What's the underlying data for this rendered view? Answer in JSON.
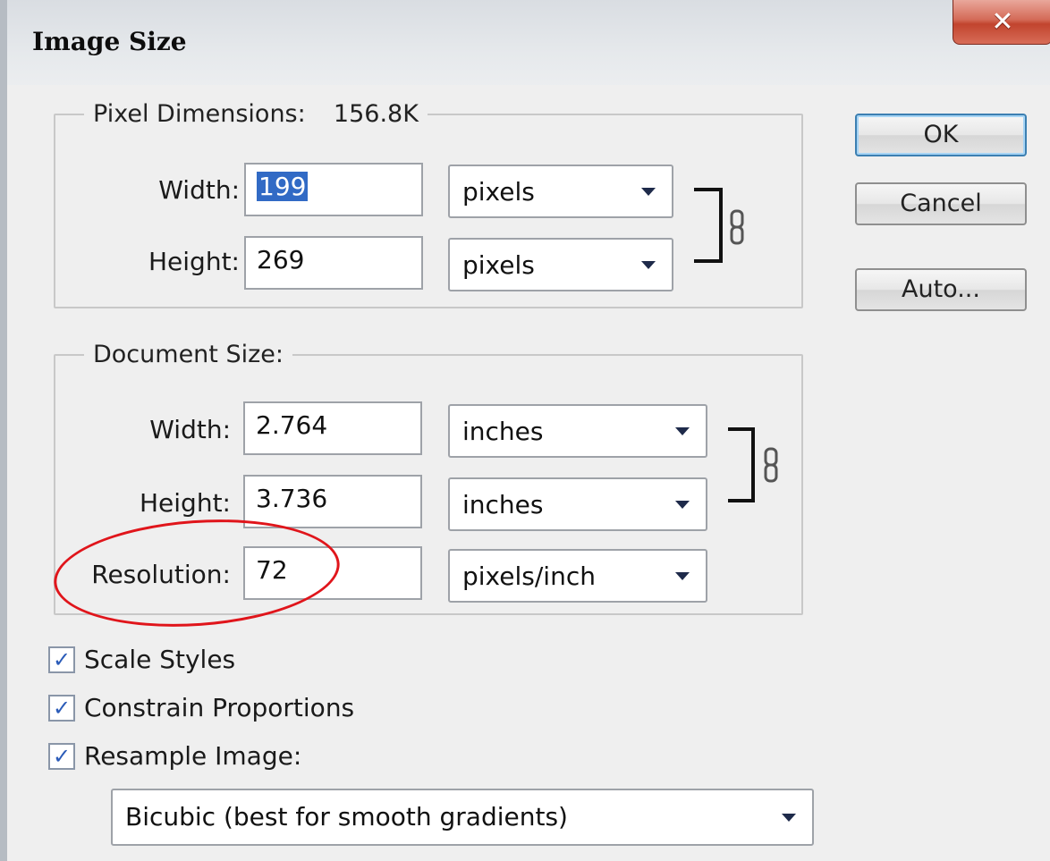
{
  "window": {
    "title": "Image Size",
    "close_glyph": "✕"
  },
  "pixel_dimensions": {
    "legend_label": "Pixel Dimensions:",
    "legend_value": "156.8K",
    "width_label": "Width:",
    "width_value": "199",
    "width_unit": "pixels",
    "height_label": "Height:",
    "height_value": "269",
    "height_unit": "pixels",
    "link_icon": "chain-link-icon"
  },
  "document_size": {
    "legend_label": "Document Size:",
    "width_label": "Width:",
    "width_value": "2.764",
    "width_unit": "inches",
    "height_label": "Height:",
    "height_value": "3.736",
    "height_unit": "inches",
    "resolution_label": "Resolution:",
    "resolution_value": "72",
    "resolution_unit": "pixels/inch",
    "link_icon": "chain-link-icon"
  },
  "buttons": {
    "ok": "OK",
    "cancel": "Cancel",
    "auto": "Auto..."
  },
  "options": {
    "scale_styles": {
      "label": "Scale Styles",
      "checked": true
    },
    "constrain_proportions": {
      "label": "Constrain Proportions",
      "checked": true
    },
    "resample_image": {
      "label": "Resample Image:",
      "checked": true
    },
    "resample_method": "Bicubic (best for smooth gradients)"
  },
  "annotation": {
    "highlight_color": "#e0151b"
  },
  "colors": {
    "selection": "#316ac5",
    "close_button": "#c1442e"
  }
}
